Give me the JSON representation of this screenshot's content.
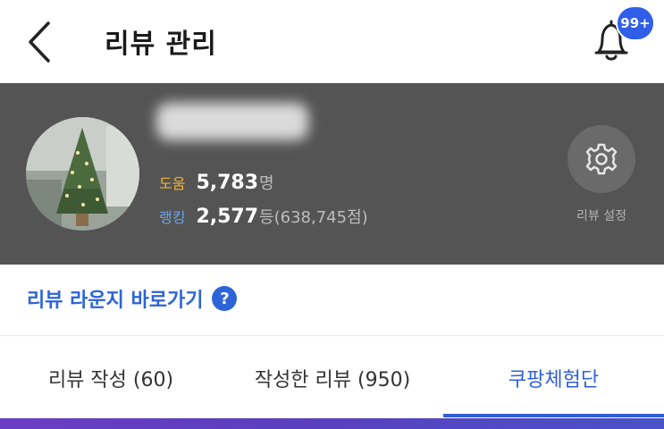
{
  "header": {
    "title": "리뷰 관리",
    "notification_badge": "99+"
  },
  "profile": {
    "help_label": "도움",
    "help_count": "5,783",
    "help_unit": "명",
    "rank_label": "랭킹",
    "rank_value": "2,577",
    "rank_unit": "등",
    "rank_score": " (638,745점)",
    "settings_label": "리뷰 설정"
  },
  "lounge": {
    "link_text": "리뷰 라운지 바로가기",
    "help_icon_text": "?"
  },
  "tabs": [
    {
      "label": "리뷰 작성 (60)"
    },
    {
      "label": "작성한 리뷰 (950)"
    },
    {
      "label": "쿠팡체험단"
    }
  ],
  "colors": {
    "accent_blue": "#2d64d8",
    "panel_bg": "#545454",
    "help_label": "#f2b23a",
    "rank_label": "#6aa4e8"
  },
  "icons": {
    "back": "chevron-left-icon",
    "notification": "bell-icon",
    "settings": "gear-icon",
    "help": "question-circle-icon"
  }
}
